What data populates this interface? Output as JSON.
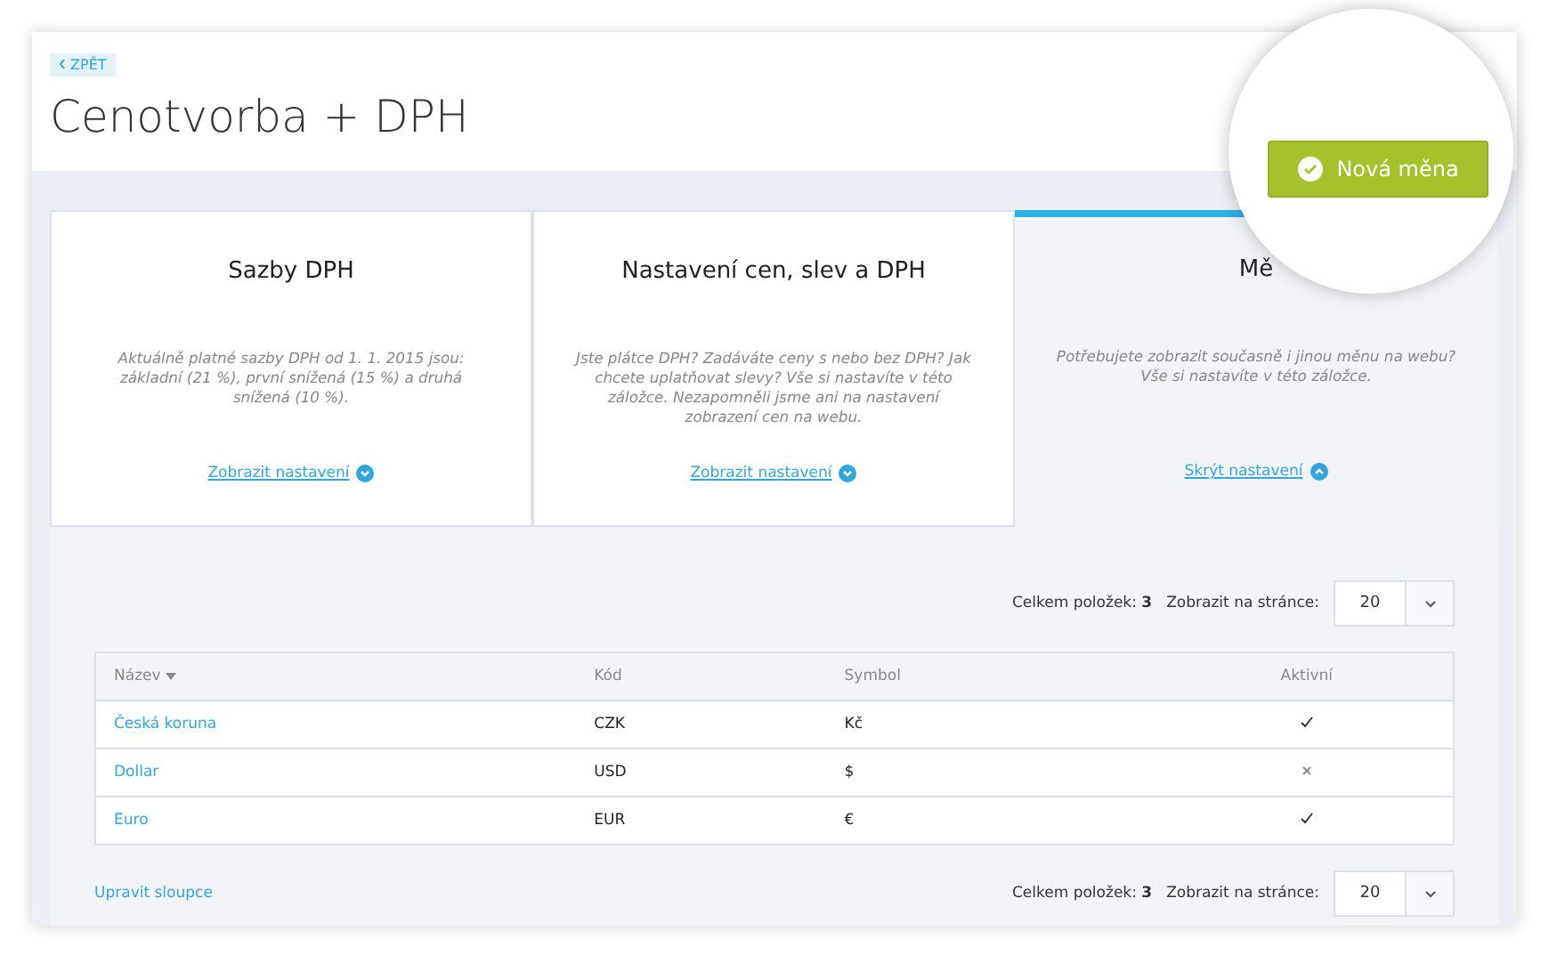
{
  "back_link": {
    "label": "ZPĚT"
  },
  "title": "Cenotvorba + DPH",
  "new_button": {
    "label": "Nová měna"
  },
  "tabs": [
    {
      "title": "Sazby DPH",
      "description": "Aktuálně platné sazby DPH od 1. 1. 2015 jsou: základní (21 %), první snížená (15 %) a druhá snížená (10 %).",
      "link": "Zobrazit nastavení",
      "selected": false
    },
    {
      "title": "Nastavení cen, slev a DPH",
      "description": "Jste plátce DPH? Zadáváte ceny s nebo bez DPH? Jak chcete uplatňovat slevy? Vše si nastavíte v této záložce. Nezapomněli jsme ani na nastavení zobrazení cen na webu.",
      "link": "Zobrazit nastavení",
      "selected": false
    },
    {
      "title": "Mě",
      "description": "Potřebujete zobrazit současně i jinou měnu na webu? Vše si nastavíte v této záložce.",
      "link": "Skrýt nastavení",
      "selected": true
    }
  ],
  "pager_top": {
    "total_label": "Celkem položek:",
    "total": "3",
    "per_page_label": "Zobrazit na stránce:",
    "per_page": "20"
  },
  "table": {
    "columns": [
      "Název",
      "Kód",
      "Symbol",
      "Aktivní"
    ],
    "rows": [
      {
        "name": "Česká koruna",
        "code": "CZK",
        "symbol": "Kč",
        "active": true
      },
      {
        "name": "Dollar",
        "code": "USD",
        "symbol": "$",
        "active": false
      },
      {
        "name": "Euro",
        "code": "EUR",
        "symbol": "€",
        "active": true
      }
    ]
  },
  "edit_columns_link": "Upravit sloupce",
  "pager_bottom": {
    "total_label": "Celkem položek:",
    "total": "3",
    "per_page_label": "Zobrazit na stránce:",
    "per_page": "20"
  }
}
